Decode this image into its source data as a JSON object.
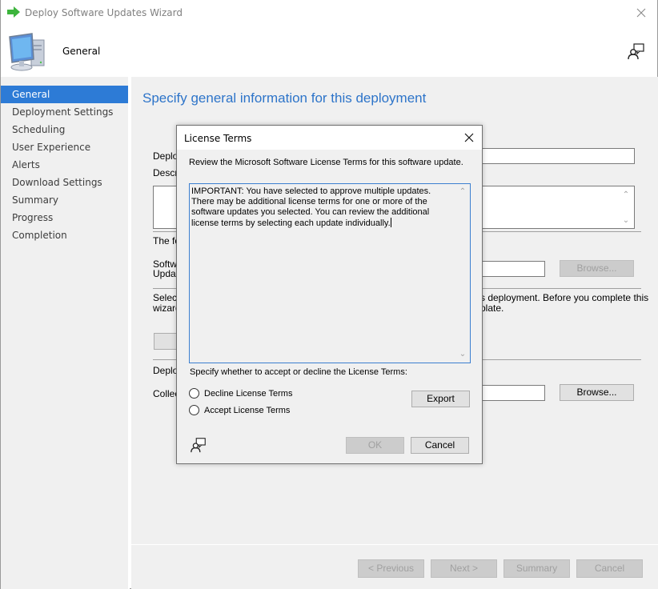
{
  "window": {
    "title": "Deploy Software Updates Wizard",
    "header_title": "General"
  },
  "sidebar": {
    "items": [
      {
        "label": "General",
        "active": true
      },
      {
        "label": "Deployment Settings",
        "active": false
      },
      {
        "label": "Scheduling",
        "active": false
      },
      {
        "label": "User Experience",
        "active": false
      },
      {
        "label": "Alerts",
        "active": false
      },
      {
        "label": "Download Settings",
        "active": false
      },
      {
        "label": "Summary",
        "active": false
      },
      {
        "label": "Progress",
        "active": false
      },
      {
        "label": "Completion",
        "active": false
      }
    ]
  },
  "main": {
    "heading": "Specify general information for this deployment",
    "deployment_name_label": "Deploy",
    "description_label": "Descri",
    "following_text": "The fo",
    "software_label_line1": "Softwa",
    "software_label_line2": "Updat",
    "browse_disabled_label": "Browse...",
    "select_text_line1_left": "Select",
    "select_text_line2_left": "wizard",
    "select_text_line1_right": "s deployment. Before you complete this",
    "select_text_line2_right": "plate.",
    "deploy_section_label": "Deploy",
    "collection_label": "Collec",
    "browse_label": "Browse..."
  },
  "footer": {
    "previous": "< Previous",
    "next": "Next >",
    "summary": "Summary",
    "cancel": "Cancel"
  },
  "modal": {
    "title": "License Terms",
    "description": "Review the Microsoft Software License Terms for this software update.",
    "license_text": "IMPORTANT:  You have selected to approve multiple updates.  There may be additional license terms for one or more of the software updates you selected.  You can review the additional license terms by selecting each update individually.",
    "specify_text": "Specify whether to accept or decline the License Terms:",
    "decline_label": "Decline License Terms",
    "accept_label": "Accept License Terms",
    "export_label": "Export",
    "ok_label": "OK",
    "cancel_label": "Cancel"
  },
  "colors": {
    "accent": "#2d7bd6",
    "heading": "#2d74c9",
    "title_arrow": "#3cb43c"
  }
}
